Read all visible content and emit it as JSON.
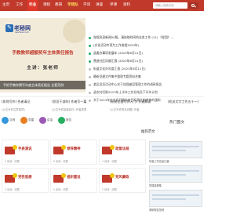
{
  "topnav": {
    "items": [
      {
        "label": "主页",
        "state": "normal"
      },
      {
        "label": "工作",
        "state": "normal"
      },
      {
        "label": "作业",
        "state": "active"
      },
      {
        "label": "课程",
        "state": "normal"
      },
      {
        "label": "教研",
        "state": "normal"
      },
      {
        "label": "学团队",
        "state": "green"
      },
      {
        "label": "学问",
        "state": "normal"
      },
      {
        "label": "讲座",
        "state": "normal"
      },
      {
        "label": "评课",
        "state": "normal"
      },
      {
        "label": "资料",
        "state": "normal"
      }
    ],
    "search_placeholder": "请输入搜索内容"
  },
  "banner": {
    "logo_title": "老秘网",
    "logo_url": "laomiw.com",
    "headline": "手教教师超额奖年主体责任报告",
    "speaker": "主讲：张老师",
    "caption": "手把手教你撰写年度主体责任报告 全套范例"
  },
  "news": {
    "rows": [
      {
        "text": "党规风采新闻50版，请协助时间的业务工作 (11) 《党团》...",
        "hot": true
      },
      {
        "text": "(文化活动专项为工作流程2024年)",
        "hot": true
      },
      {
        "text": "县委办事项发展年 (2023年6月11日)",
        "hot": true
      },
      {
        "text": "营造社区风貌汇报 (2023年6月11日)",
        "hot": true
      },
      {
        "text": "街道文化办年度汇报 (2023年6月11日)",
        "hot": false
      },
      {
        "text": "最新党建文件集中整理专题资料合集",
        "hot": false
      },
      {
        "text": "某区党员活动中心关于加强基层管理工作的调研报告",
        "hot": false
      },
      {
        "text": "县农村妇联2023年上半年工作总结及下半年计划",
        "hot": false
      },
      {
        "text": "关于2023年在全县开展年度目标责任制考核的通知",
        "hot": false
      }
    ]
  },
  "topics": {
    "items": [
      {
        "title": "(如何写作) 作者请记",
        "sub": "(公文写作注意事项)"
      },
      {
        "title": "(党员干部的) 作者写一篇",
        "sub": "(公文写作高级技巧) 作者发表"
      },
      {
        "title": "(机关全面写作入门) 作者解读",
        "sub": "(公文写作常见问题) 作者"
      },
      {
        "title": "(机关文字工作五十一)",
        "sub": ""
      }
    ]
  },
  "circles": {
    "items": [
      {
        "label": "文明",
        "color": "#3498db"
      },
      {
        "label": "党建",
        "color": "#e67e22"
      },
      {
        "label": "讲话",
        "color": "#9b59b6"
      },
      {
        "label": "报告",
        "color": "#27ae60"
      }
    ]
  },
  "cards": [
    {
      "title": "手表演说",
      "meta": "3 阅读 · 收藏"
    },
    {
      "title": "领导精神",
      "meta": "6 阅读 · 收藏"
    },
    {
      "title": "政策法规",
      "meta": "4 阅读 · 收藏"
    },
    {
      "title": "党性思想",
      "meta": "3 阅读 · 收藏"
    },
    {
      "title": "组织建设",
      "meta": "5 阅读 · 收藏"
    },
    {
      "title": "党风廉政",
      "meta": "2 阅读 · 收藏"
    }
  ],
  "sidebar": {
    "title": "热门图文",
    "section_label": "推荐范文",
    "thumbs": [
      {
        "label": "年度工作总结汇编"
      },
      {
        "label": "党课讲稿集"
      },
      {
        "label": "调研报告范例"
      }
    ]
  },
  "colors": {
    "brand": "#c0392b",
    "accent_green": "#27ae60",
    "badge_gold": "#f1c40f"
  }
}
